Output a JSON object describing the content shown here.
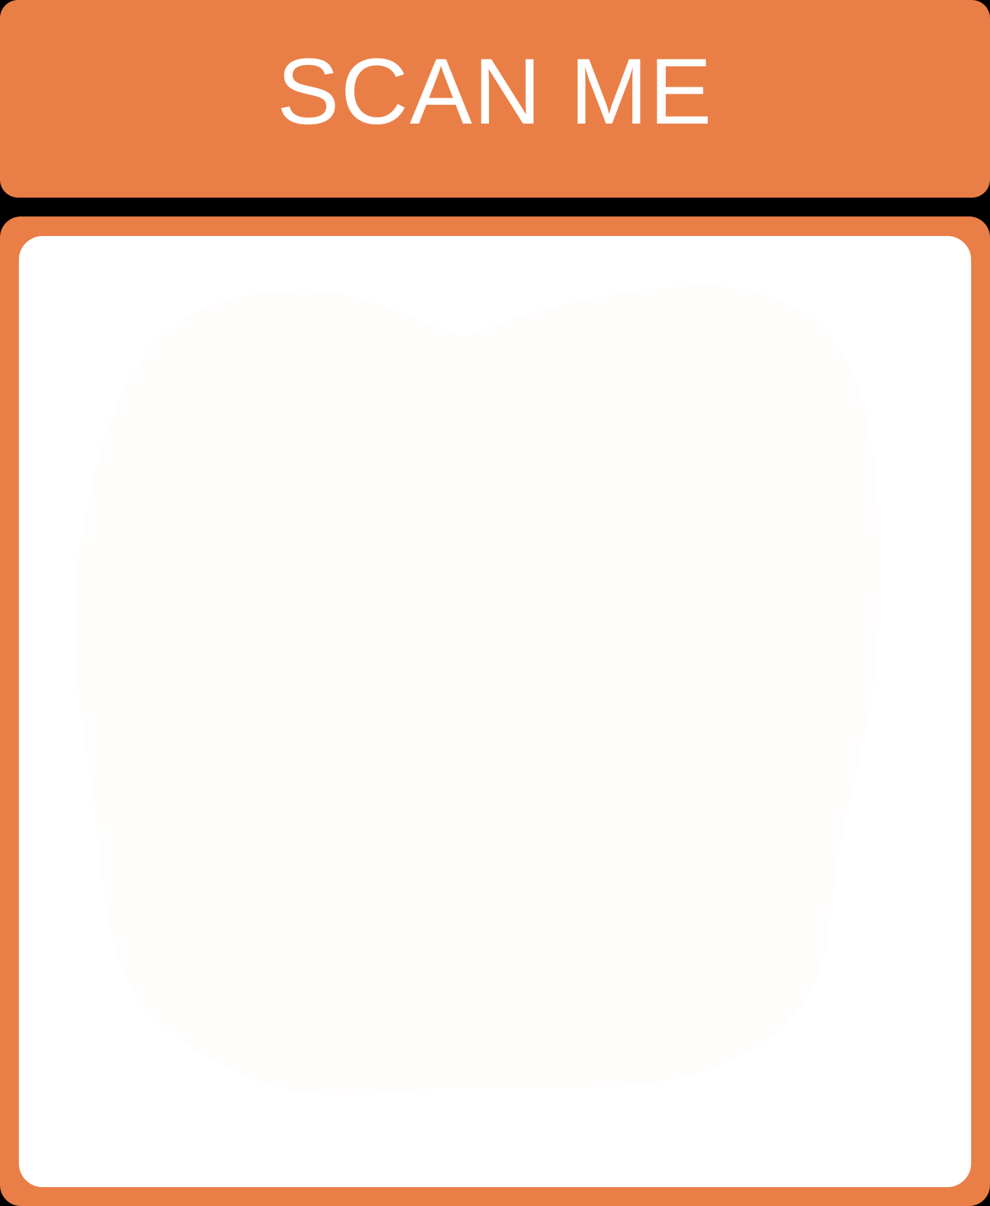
{
  "header": {
    "title": "SCAN ME"
  },
  "colors": {
    "accent": "#E97F47",
    "background": "#000000",
    "code_area": "#FFFFFF",
    "code_blob": "#FFFCFC"
  },
  "code_panel": {
    "icon": "qr-code-placeholder-icon"
  }
}
